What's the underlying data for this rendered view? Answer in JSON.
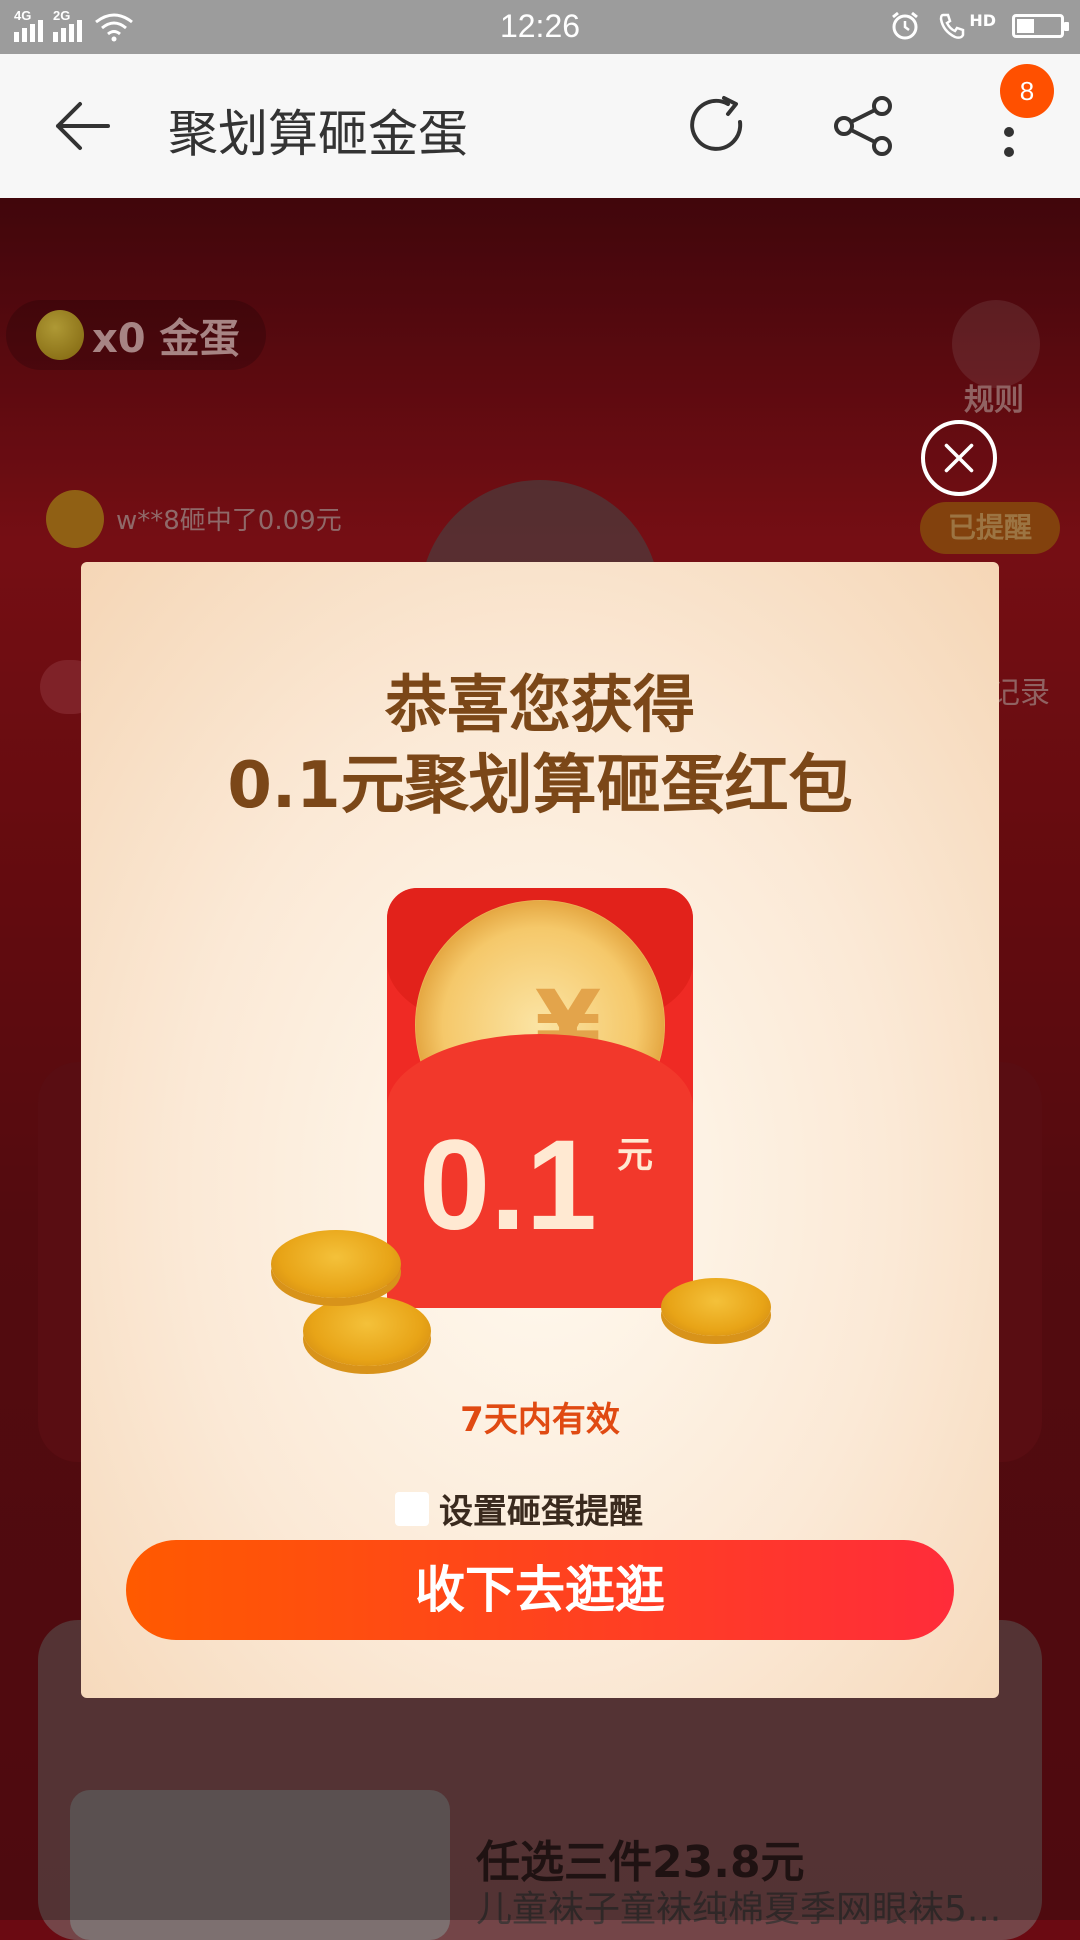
{
  "status_bar": {
    "signal_1": "4G",
    "signal_2": "2G",
    "time": "12:26",
    "hd": "HD",
    "battery_level": 0.4
  },
  "navbar": {
    "title": "聚划算砸金蛋",
    "badge_count": "8",
    "icons": [
      "back-arrow-icon",
      "refresh-icon",
      "share-icon",
      "more-icon"
    ]
  },
  "background": {
    "egg_count": "x0 金蛋",
    "rules_label": "规则",
    "ticker": "w**8砸中了0.09元",
    "reminded_label": "已提醒",
    "record_label": "记录",
    "deal_title": "任选三件23.8元",
    "deal_subtitle": "儿童袜子童袜纯棉夏季网眼袜5..."
  },
  "modal": {
    "title_line1": "恭喜您获得",
    "title_line2": "0.1元聚划算砸蛋红包",
    "amount": "0.1",
    "unit": "元",
    "yen_symbol": "¥",
    "validity": "7天内有效",
    "reminder_label": "设置砸蛋提醒",
    "reminder_checked": false,
    "cta_label": "收下去逛逛"
  },
  "colors": {
    "accent_orange": "#ff5000",
    "cta_start": "#ff5a00",
    "cta_end": "#ff2c3a",
    "title_brown": "#7b4718",
    "packet_red": "#ef2a24"
  }
}
